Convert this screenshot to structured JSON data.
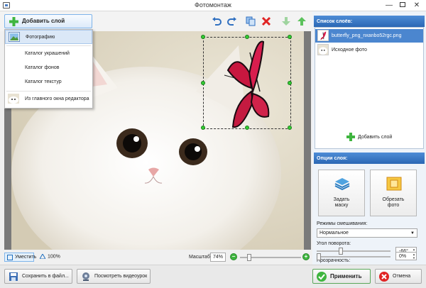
{
  "window": {
    "title": "Фотомонтаж",
    "minimize": "—",
    "close": "✕"
  },
  "toolbar": {
    "add_layer_label": "Добавить слой",
    "icons": [
      "undo-icon",
      "redo-icon",
      "copy-icon",
      "delete-icon",
      "move-down-icon",
      "move-up-icon"
    ]
  },
  "menu": {
    "items": [
      {
        "label": "Фотографию",
        "icon": "photo-icon",
        "active": true
      },
      {
        "label": "Каталог украшений",
        "icon": "",
        "active": false
      },
      {
        "label": "Каталог фонов",
        "icon": "",
        "active": false
      },
      {
        "label": "Каталог текстур",
        "icon": "",
        "active": false
      },
      {
        "label": "Из главного окна редактора",
        "icon": "kitten-thumbnail",
        "active": false
      }
    ]
  },
  "statusbar": {
    "fit_label": "Уместить",
    "zoom_100_label": "100%",
    "scale_label": "Масштаб:",
    "scale_value": "74%",
    "zoom_slider_level": 0.12
  },
  "bottombar": {
    "save_label": "Сохранить в файл...",
    "video_label": "Посмотреть видеоурок",
    "apply_label": "Применить",
    "cancel_label": "Отмена"
  },
  "right_panel": {
    "layers_header": "Список слоёв:",
    "layers": [
      {
        "name": "butterfly_png_nxanbo52rgc.png",
        "active": true,
        "thumb": "butterfly-thumbnail"
      },
      {
        "name": "Исходное фото",
        "active": false,
        "thumb": "kitten-thumbnail"
      }
    ],
    "add_layer_label": "Добавить слой",
    "options_header": "Опции слоя:",
    "mask_button_label_line1": "Задать",
    "mask_button_label_line2": "маску",
    "crop_button_label_line1": "Обрезать",
    "crop_button_label_line2": "фото",
    "blend_label": "Режимы смешивания:",
    "blend_value": "Нормальное",
    "rotation_label": "Угол поворота:",
    "rotation_value": "-66°",
    "rotation_level": 0.32,
    "opacity_label": "Прозрачность:",
    "opacity_value": "0%",
    "opacity_level": 0.0
  },
  "colors": {
    "accent_blue": "#2b67b4",
    "selection_handle": "#33cc33",
    "delete_red": "#e02424",
    "move_green": "#3fb53f"
  }
}
